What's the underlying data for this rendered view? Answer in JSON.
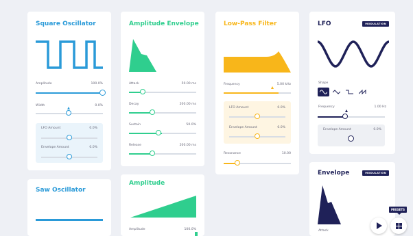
{
  "square_osc": {
    "title": "Square Oscillator",
    "amplitude_label": "Amplitude",
    "amplitude_value": "100.0%",
    "width_label": "Width",
    "width_value": "0.0%",
    "lfo_amount_label": "LFO Amount",
    "lfo_amount_value": "0.0%",
    "envelope_amount_label": "Envelope Amount",
    "envelope_amount_value": "0.0%"
  },
  "saw_osc": {
    "title": "Saw Oscillator"
  },
  "amp_env": {
    "title": "Amplitude Envelope",
    "attack_label": "Attack",
    "attack_value": "50.00 ms",
    "decay_label": "Decay",
    "decay_value": "200.00 ms",
    "sustain_label": "Sustain",
    "sustain_value": "50.0%",
    "release_label": "Release",
    "release_value": "200.00 ms"
  },
  "amplitude": {
    "title": "Amplitude",
    "amplitude_label": "Amplitude",
    "amplitude_value": "100.0%"
  },
  "lpf": {
    "title": "Low-Pass Filter",
    "frequency_label": "Frequency",
    "frequency_value": "5.00 kHz",
    "lfo_amount_label": "LFO Amount",
    "lfo_amount_value": "0.0%",
    "envelope_amount_label": "Envelope Amount",
    "envelope_amount_value": "0.0%",
    "resonance_label": "Resonance",
    "resonance_value": "10.00"
  },
  "lfo": {
    "title": "LFO",
    "badge": "MODULATION",
    "shape_label": "Shape",
    "frequency_label": "Frequency",
    "frequency_value": "1.00 Hz",
    "envelope_amount_label": "Envelope Amount",
    "envelope_amount_value": "0.0%",
    "shapes": [
      "sine",
      "triangle",
      "square",
      "sawtooth"
    ]
  },
  "envelope": {
    "title": "Envelope",
    "badge": "MODULATION",
    "attack_label": "Attack"
  },
  "presets": {
    "label": "PRESETS"
  },
  "colors": {
    "blue": "#2a9ad8",
    "green": "#2fce8e",
    "yellow": "#f8b61a",
    "navy": "#1f2158",
    "blue_box": "#eaf4fb",
    "green_box": "#e8f8f1",
    "yellow_box": "#fef5e2"
  },
  "controls": {
    "square_amplitude": 1.0,
    "square_width": 0.5,
    "square_lfo_amount": 0.5,
    "square_envelope_amount": 0.5,
    "amp_attack": 0.15,
    "amp_decay": 0.33,
    "amp_sustain": 0.5,
    "amp_release": 0.33,
    "lpf_frequency": 0.85,
    "lpf_lfo_amount": 0.5,
    "lpf_envelope_amount": 0.5,
    "lpf_resonance": 0.12,
    "lfo_frequency": 0.3,
    "lfo_envelope_amount": 0.5
  }
}
